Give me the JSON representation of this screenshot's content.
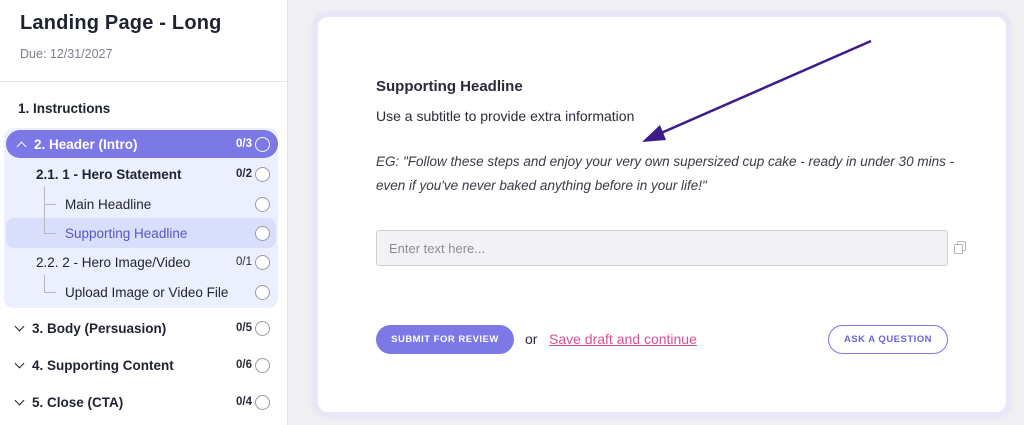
{
  "sidebar": {
    "title": "Landing Page - Long",
    "due": "Due: 12/31/2027",
    "items": [
      {
        "label": "1. Instructions"
      },
      {
        "label": "2. Header (Intro)",
        "count": "0/3"
      },
      {
        "label": "2.1. 1 - Hero Statement",
        "count": "0/2"
      },
      {
        "label": "Main Headline"
      },
      {
        "label": "Supporting Headline"
      },
      {
        "label": "2.2. 2 - Hero Image/Video",
        "count": "0/1"
      },
      {
        "label": "Upload Image or Video File"
      },
      {
        "label": "3. Body (Persuasion)",
        "count": "0/5"
      },
      {
        "label": "4. Supporting Content",
        "count": "0/6"
      },
      {
        "label": "5. Close (CTA)",
        "count": "0/4"
      }
    ]
  },
  "main": {
    "title": "Supporting Headline",
    "subtitle": "Use a subtitle to provide extra information",
    "example_line1": "EG: \"Follow these steps and enjoy your very own supersized cup cake - ready in under 30 mins -",
    "example_line2": "even if you've never baked anything before in your life!\"",
    "input_placeholder": "Enter text here...",
    "submit_label": "SUBMIT FOR REVIEW",
    "or_text": "or",
    "save_label": "Save draft and continue",
    "ask_label": "ASK A QUESTION"
  },
  "colors": {
    "accent": "#7c78e6",
    "link": "#d64f8f",
    "arrow": "#3d1b8a"
  },
  "icons": [
    "chevron-up-icon",
    "chevron-down-icon",
    "status-circle-icon",
    "copy-icon",
    "arrow-annotation-icon"
  ]
}
